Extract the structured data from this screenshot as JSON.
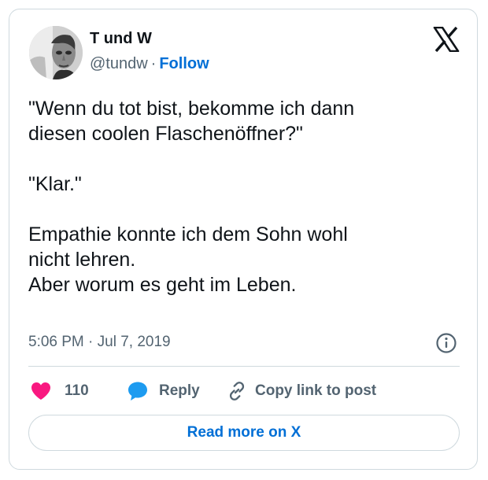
{
  "author": {
    "name": "T und W",
    "handle": "@tundw",
    "separator": "·",
    "follow_label": "Follow"
  },
  "tweet": {
    "paragraphs": [
      "\"Wenn du tot bist, bekomme ich dann\ndiesen coolen Flaschenöffner?\"",
      "\"Klar.\"",
      "Empathie konnte ich dem Sohn wohl\nnicht lehren.\nAber worum es geht im Leben."
    ],
    "timestamp": "5:06 PM · Jul 7, 2019"
  },
  "actions": {
    "like_count": "110",
    "reply_label": "Reply",
    "copy_link_label": "Copy link to post"
  },
  "read_more_label": "Read more on X",
  "colors": {
    "like": "#f91880",
    "reply": "#1d9bf0",
    "link": "#006fd6",
    "muted": "#536471",
    "border": "#cfd9de"
  },
  "icons": {
    "platform": "x-logo-icon",
    "info": "info-icon",
    "like": "heart-icon",
    "reply": "speech-bubble-icon",
    "copy": "link-icon"
  }
}
